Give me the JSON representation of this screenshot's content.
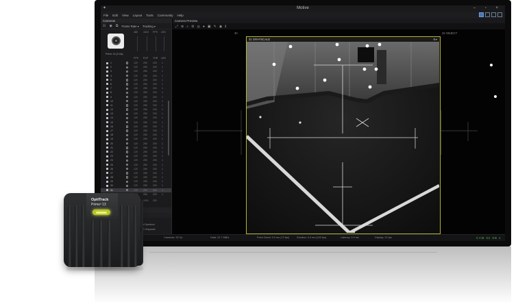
{
  "window": {
    "title": "Motive",
    "controls": "– ▫ ×"
  },
  "menu": [
    "File",
    "Edit",
    "View",
    "Layout",
    "Tools",
    "Community",
    "Help"
  ],
  "left_panel": {
    "header": "Cameras",
    "toolbar": [
      "Frame Rate ▾",
      "Tracking ▾"
    ],
    "camera_columns": [
      "FPS",
      "EXP",
      "THR",
      "LED"
    ],
    "thumbnail_columns": [
      "480",
      "1024",
      "FPS",
      "LED"
    ],
    "camera_label": "Prime 13 (8 Ids)",
    "cameras": [
      {
        "id": "1",
        "vals": [
          "120",
          "250",
          "200",
          "1"
        ]
      },
      {
        "id": "2",
        "vals": [
          "120",
          "250",
          "200",
          "1"
        ]
      },
      {
        "id": "3",
        "vals": [
          "120",
          "250",
          "200",
          "1"
        ]
      },
      {
        "id": "4",
        "vals": [
          "120",
          "250",
          "200",
          "1"
        ]
      },
      {
        "id": "5",
        "vals": [
          "120",
          "250",
          "200",
          "1"
        ]
      },
      {
        "id": "6",
        "vals": [
          "120",
          "250",
          "200",
          "1"
        ]
      },
      {
        "id": "7",
        "vals": [
          "120",
          "250",
          "200",
          "1"
        ]
      },
      {
        "id": "8",
        "vals": [
          "120",
          "250",
          "200",
          "1"
        ]
      },
      {
        "id": "9",
        "vals": [
          "120",
          "250",
          "200",
          "1"
        ]
      },
      {
        "id": "10",
        "vals": [
          "120",
          "250",
          "200",
          "1"
        ]
      },
      {
        "id": "11",
        "vals": [
          "120",
          "250",
          "200",
          "1"
        ]
      },
      {
        "id": "12",
        "vals": [
          "120",
          "250",
          "200",
          "1"
        ]
      },
      {
        "id": "13",
        "vals": [
          "120",
          "250",
          "200",
          "1"
        ]
      },
      {
        "id": "14",
        "vals": [
          "120",
          "250",
          "200",
          "1"
        ]
      },
      {
        "id": "15",
        "vals": [
          "120",
          "250",
          "200",
          "1"
        ]
      },
      {
        "id": "16",
        "vals": [
          "120",
          "250",
          "200",
          "1"
        ]
      },
      {
        "id": "17",
        "vals": [
          "120",
          "250",
          "200",
          "1"
        ]
      },
      {
        "id": "18",
        "vals": [
          "120",
          "250",
          "200",
          "1"
        ]
      },
      {
        "id": "19",
        "vals": [
          "120",
          "250",
          "200",
          "1"
        ]
      },
      {
        "id": "20",
        "vals": [
          "120",
          "250",
          "200",
          "1"
        ]
      },
      {
        "id": "21",
        "vals": [
          "120",
          "250",
          "200",
          "1"
        ]
      },
      {
        "id": "22",
        "vals": [
          "120",
          "250",
          "200",
          "1"
        ]
      },
      {
        "id": "23",
        "vals": [
          "120",
          "250",
          "200",
          "1"
        ]
      },
      {
        "id": "24",
        "vals": [
          "120",
          "250",
          "200",
          "1"
        ]
      },
      {
        "id": "25",
        "vals": [
          "120",
          "250",
          "200",
          "1"
        ]
      },
      {
        "id": "26",
        "vals": [
          "120",
          "250",
          "200",
          "1"
        ]
      },
      {
        "id": "27",
        "vals": [
          "120",
          "250",
          "200",
          "1"
        ]
      },
      {
        "id": "28",
        "vals": [
          "120",
          "250",
          "200",
          "1"
        ]
      },
      {
        "id": "29",
        "vals": [
          "120",
          "250",
          "200",
          "1"
        ]
      },
      {
        "id": "30",
        "vals": [
          "120",
          "250",
          "200",
          "1"
        ]
      },
      {
        "id": "31",
        "vals": [
          "120",
          "250",
          "200",
          "1"
        ]
      },
      {
        "id": "32",
        "vals": [
          "120",
          "250",
          "200",
          "1"
        ]
      }
    ],
    "reference": {
      "label": "Reference (8)",
      "vals": [
        "30",
        "1024",
        "250"
      ]
    },
    "properties": {
      "title": "Properties",
      "subtitle": "31 Prime13 P03",
      "section": "Camera Settings",
      "rows": [
        {
          "k": "Gain",
          "v": "1"
        },
        {
          "k": "Filter Switch",
          "v": "Infrared Spectrum"
        },
        {
          "k": "Video Type",
          "v": "MJPEG Grayscale"
        }
      ]
    }
  },
  "viewport": {
    "header": "Camera Preview",
    "main_pane_label": "31 GRAYSCALE",
    "left_pane_label": "30",
    "right_pane_label": "32 OBJECT"
  },
  "status_bar": {
    "items": [
      "Cameras: 32 Vp",
      "Data: 21.7 MB/s",
      "Point Cloud: 0.0 ms (72 fps)",
      "Solution: 0.0 ms (240 fps)",
      "Latency: 0.0 ms",
      "Display: 22 fps"
    ],
    "indicators": "CAM 32 SB 1"
  },
  "device": {
    "brand": "OptiTrack",
    "model": "Prime³ 13"
  }
}
